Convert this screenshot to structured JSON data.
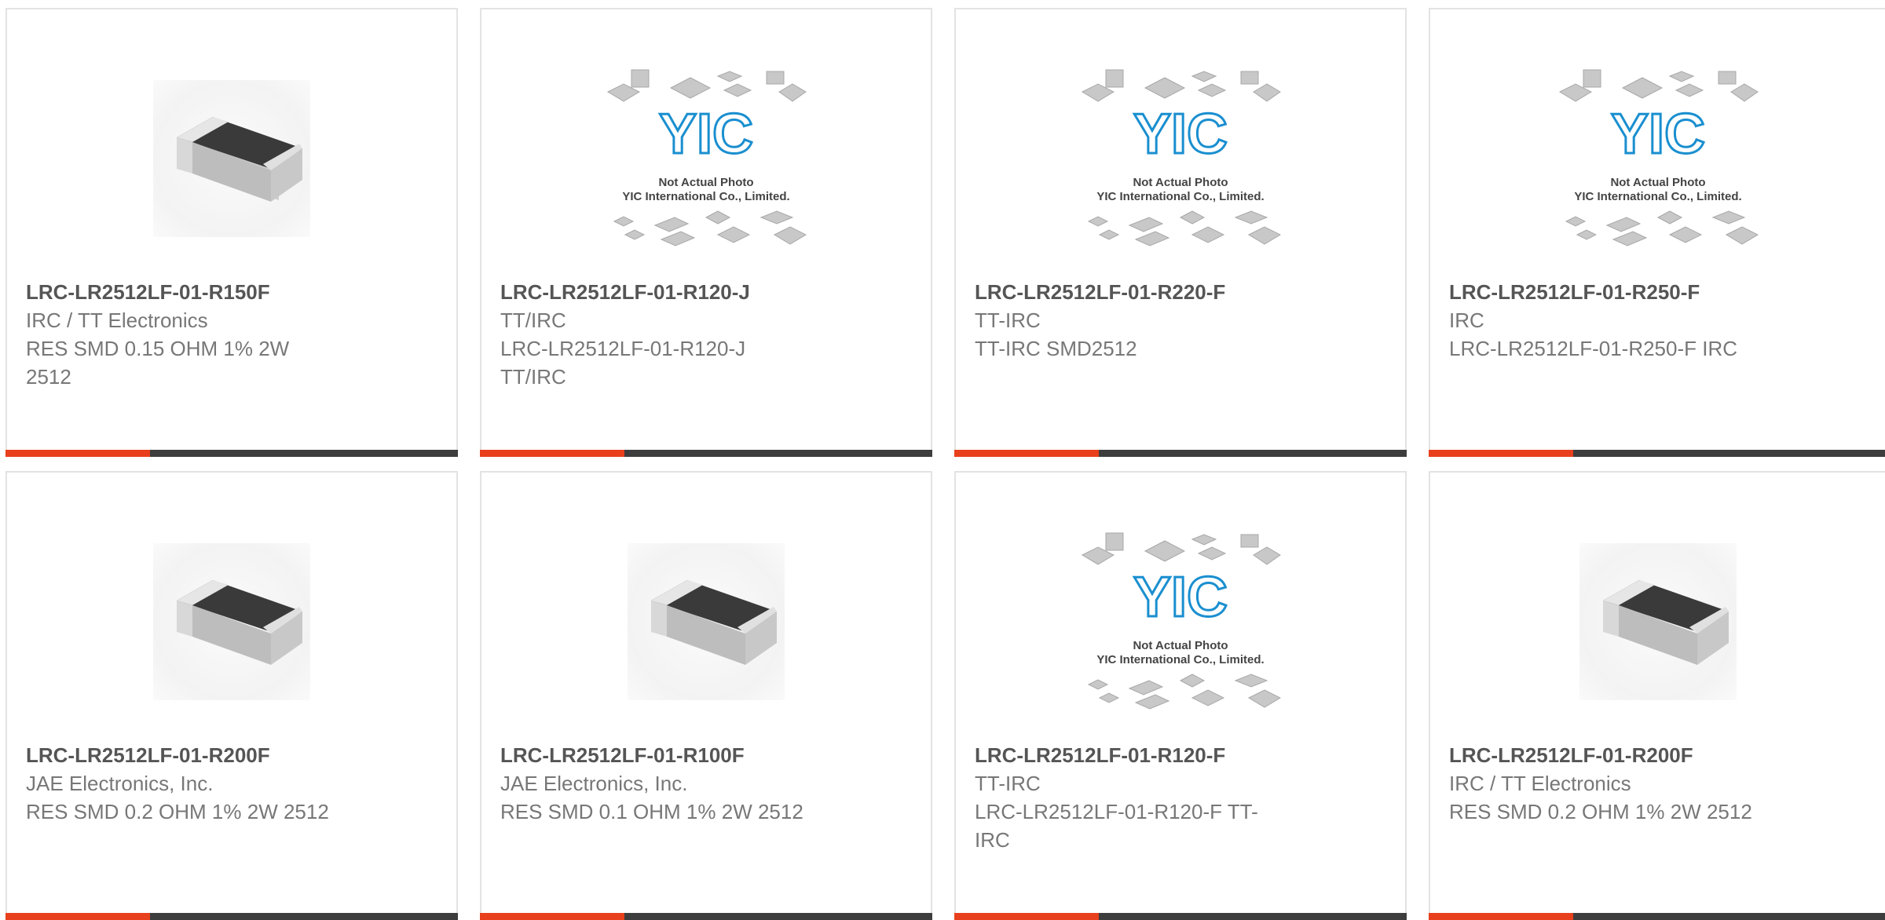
{
  "products": [
    {
      "part_number": "LRC-LR2512LF-01-R150F",
      "manufacturer": "IRC / TT Electronics",
      "description_lines": [
        "RES SMD 0.15 OHM 1% 2W",
        "2512"
      ],
      "image": "chip-resistor-photo"
    },
    {
      "part_number": "LRC-LR2512LF-01-R120-J",
      "manufacturer": "TT/IRC",
      "description_lines": [
        "LRC-LR2512LF-01-R120-J",
        "TT/IRC"
      ],
      "image": "yic-placeholder"
    },
    {
      "part_number": "LRC-LR2512LF-01-R220-F",
      "manufacturer": "TT-IRC",
      "description_lines": [
        "TT-IRC SMD2512",
        ""
      ],
      "image": "yic-placeholder"
    },
    {
      "part_number": "LRC-LR2512LF-01-R250-F",
      "manufacturer": "IRC",
      "description_lines": [
        "LRC-LR2512LF-01-R250-F IRC",
        ""
      ],
      "image": "yic-placeholder"
    },
    {
      "part_number": "LRC-LR2512LF-01-R200F",
      "manufacturer": "JAE Electronics, Inc.",
      "description_lines": [
        "RES SMD 0.2 OHM 1% 2W 2512",
        ""
      ],
      "image": "chip-resistor-photo"
    },
    {
      "part_number": "LRC-LR2512LF-01-R100F",
      "manufacturer": "JAE Electronics, Inc.",
      "description_lines": [
        "RES SMD 0.1 OHM 1% 2W 2512",
        ""
      ],
      "image": "chip-resistor-photo"
    },
    {
      "part_number": "LRC-LR2512LF-01-R120-F",
      "manufacturer": "TT-IRC",
      "description_lines": [
        "LRC-LR2512LF-01-R120-F TT-",
        "IRC"
      ],
      "image": "yic-placeholder"
    },
    {
      "part_number": "LRC-LR2512LF-01-R200F",
      "manufacturer": "IRC / TT Electronics",
      "description_lines": [
        "RES SMD 0.2 OHM 1% 2W 2512",
        ""
      ],
      "image": "chip-resistor-photo"
    }
  ],
  "placeholder": {
    "logo": "YIC",
    "line1": "Not Actual Photo",
    "line2": "YIC International Co., Limited."
  },
  "colors": {
    "accent": "#e8401c",
    "bar": "#3d3d3d",
    "logo_blue": "#1a8fd0"
  }
}
